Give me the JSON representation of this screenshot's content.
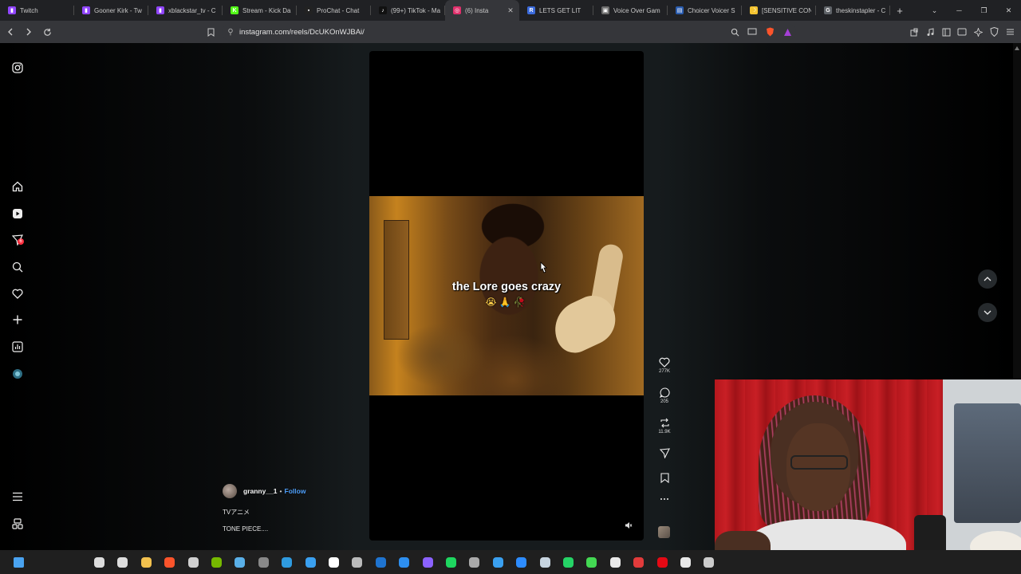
{
  "browser": {
    "tabs": [
      {
        "title": "Twitch",
        "favicon_color": "#9146ff",
        "favicon_glyph": "▮"
      },
      {
        "title": "Gooner Kirk - Tw",
        "favicon_color": "#9146ff",
        "favicon_glyph": "▮"
      },
      {
        "title": "xblackstar_tv - C",
        "favicon_color": "#9146ff",
        "favicon_glyph": "▮"
      },
      {
        "title": "Stream - Kick Da",
        "favicon_color": "#53fc18",
        "favicon_glyph": "K"
      },
      {
        "title": "ProChat - Chat",
        "favicon_color": "#222222",
        "favicon_glyph": "▪"
      },
      {
        "title": "(99+) TikTok - Ma",
        "favicon_color": "#111111",
        "favicon_glyph": "♪"
      },
      {
        "title": "(6) Insta",
        "favicon_color": "#e1306c",
        "favicon_glyph": "◎",
        "active": true
      },
      {
        "title": "LETS GET LIT",
        "favicon_color": "#3b6bdc",
        "favicon_glyph": "R"
      },
      {
        "title": "Voice Over Gam",
        "favicon_color": "#6d6d6d",
        "favicon_glyph": "▣"
      },
      {
        "title": "Choicer Voicer S",
        "favicon_color": "#2a5db0",
        "favicon_glyph": "▤"
      },
      {
        "title": "[SENSITIVE CON",
        "favicon_color": "#f4c430",
        "favicon_glyph": "☽"
      },
      {
        "title": "theskinstapler - C",
        "favicon_color": "#5f6368",
        "favicon_glyph": "G"
      }
    ],
    "window_controls": [
      "⌄",
      "─",
      "❐",
      "✕"
    ],
    "url": "instagram.com/reels/DcUKOnWJBAi/",
    "new_tab": "+"
  },
  "instagram": {
    "nav_icons": [
      "instagram-logo-icon",
      "home-icon",
      "reels-icon",
      "messages-icon",
      "search-icon",
      "notifications-icon",
      "create-icon",
      "dashboard-icon",
      "profile-icon",
      "menu-icon",
      "threads-icon"
    ],
    "messages_badge": "6",
    "reel": {
      "caption": "the Lore goes crazy",
      "emoji": "😭🙏🥀",
      "author": "granny__1",
      "follow_label": "Follow",
      "description_line1": "TVアニメ",
      "description_line2": "TONE PIECE....",
      "likes": "277K",
      "comments": "205",
      "reposts": "11.9K"
    }
  },
  "taskbar": {
    "apps": [
      {
        "name": "start-icon",
        "color": "#4aa3f0"
      },
      {
        "name": "search-icon",
        "color": "#dddddd"
      },
      {
        "name": "task-view-icon",
        "color": "#dddddd"
      },
      {
        "name": "file-explorer-icon",
        "color": "#f2c14e"
      },
      {
        "name": "brave-icon",
        "color": "#fb542b"
      },
      {
        "name": "obs-icon",
        "color": "#d0d0d0"
      },
      {
        "name": "nvidia-icon",
        "color": "#76b900"
      },
      {
        "name": "photos-icon",
        "color": "#5ab0e8"
      },
      {
        "name": "app-icon",
        "color": "#888888"
      },
      {
        "name": "edge-icon",
        "color": "#2f9be0"
      },
      {
        "name": "ps-icon",
        "color": "#3aa0f0"
      },
      {
        "name": "notion-icon",
        "color": "#ffffff"
      },
      {
        "name": "terminal-icon",
        "color": "#bbbbbb"
      },
      {
        "name": "outlook-icon",
        "color": "#1f74d0"
      },
      {
        "name": "docs-icon",
        "color": "#2d8ff0"
      },
      {
        "name": "grid-app-icon",
        "color": "#8b62ff"
      },
      {
        "name": "spotify-icon",
        "color": "#1ed760"
      },
      {
        "name": "terminal2-icon",
        "color": "#aaaaaa"
      },
      {
        "name": "store-icon",
        "color": "#3aa0f0"
      },
      {
        "name": "zoom-icon",
        "color": "#2d8cff"
      },
      {
        "name": "steam-icon",
        "color": "#c7d5e0"
      },
      {
        "name": "whatsapp-icon",
        "color": "#25d366"
      },
      {
        "name": "chat-icon",
        "color": "#43d853"
      },
      {
        "name": "obs2-icon",
        "color": "#e8e8e8"
      },
      {
        "name": "app2-icon",
        "color": "#e23b3b"
      },
      {
        "name": "netflix-icon",
        "color": "#e50914"
      },
      {
        "name": "chrome-icon",
        "color": "#e8e8e8"
      },
      {
        "name": "capture-icon",
        "color": "#cccccc"
      }
    ]
  }
}
